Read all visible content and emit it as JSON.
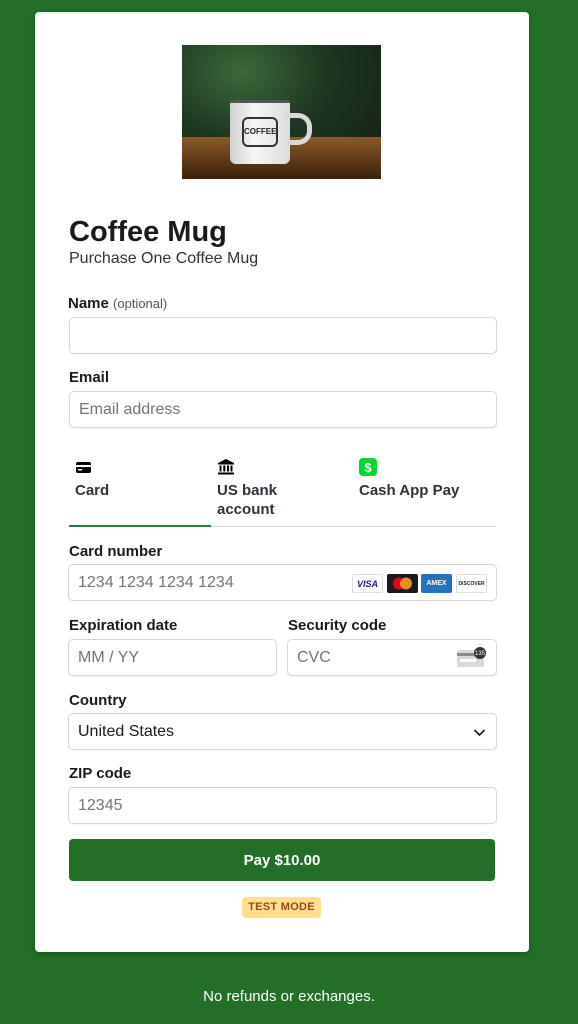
{
  "product": {
    "title": "Coffee Mug",
    "subtitle": "Purchase One Coffee Mug",
    "image_text": "COFFEE"
  },
  "fields": {
    "name_label": "Name",
    "name_optional": "(optional)",
    "name_value": "",
    "email_label": "Email",
    "email_placeholder": "Email address",
    "card_number_label": "Card number",
    "card_number_placeholder": "1234 1234 1234 1234",
    "expiration_label": "Expiration date",
    "expiration_placeholder": "MM / YY",
    "security_label": "Security code",
    "security_placeholder": "CVC",
    "cvc_icon_text": "135",
    "country_label": "Country",
    "country_value": "United States",
    "zip_label": "ZIP code",
    "zip_placeholder": "12345"
  },
  "payment_tabs": [
    {
      "label": "Card",
      "icon": "credit-card-icon",
      "active": true
    },
    {
      "label": "US bank account",
      "icon": "bank-icon",
      "active": false
    },
    {
      "label": "Cash App Pay",
      "icon": "cash-app-icon",
      "active": false
    }
  ],
  "card_brands": [
    "VISA",
    "mastercard",
    "AMEX",
    "DISCOVER"
  ],
  "pay_button_label": "Pay $10.00",
  "test_mode_label": "TEST MODE",
  "footer_text": "No refunds or exchanges.",
  "colors": {
    "background": "#236f27",
    "accent": "#236f27",
    "tab_underline": "#2b7a3d",
    "test_mode_bg": "#ffde92",
    "test_mode_text": "#a2471a"
  }
}
